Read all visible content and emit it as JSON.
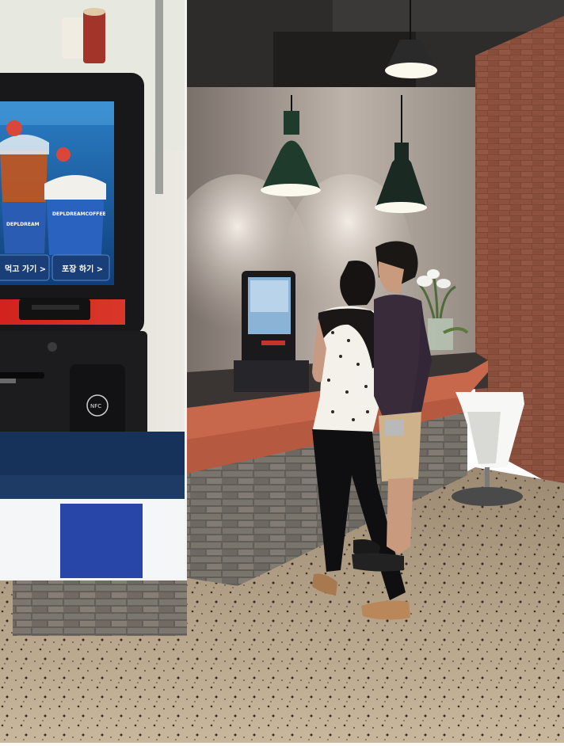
{
  "kiosk": {
    "button_left": "먹고 가기 >",
    "button_right": "포장 하기 >",
    "cup_brand": "DEPLDREAM",
    "cup_brand_right": "DEPLDREAMCOFFEE",
    "nfc_label": "NFC"
  }
}
